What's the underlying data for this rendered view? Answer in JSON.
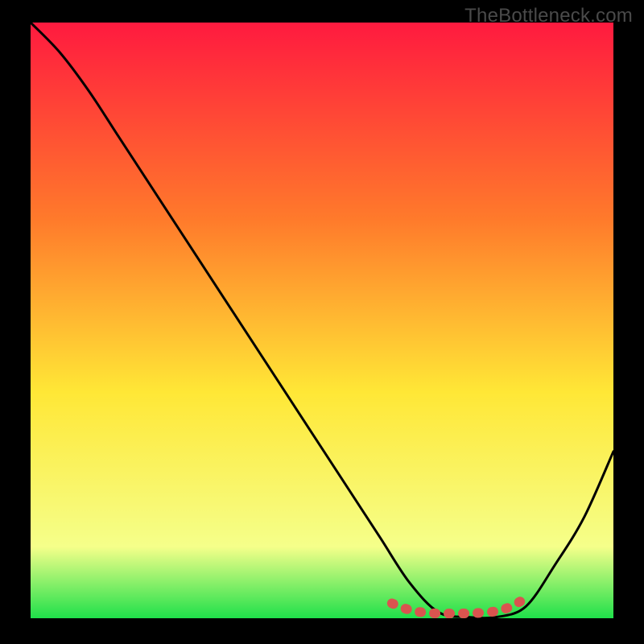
{
  "watermark": "TheBottleneck.com",
  "chart_data": {
    "type": "line",
    "title": "",
    "xlabel": "",
    "ylabel": "",
    "xlim": [
      0,
      100
    ],
    "ylim": [
      0,
      100
    ],
    "grid": false,
    "x": [
      0,
      5,
      10,
      15,
      20,
      25,
      30,
      35,
      40,
      45,
      50,
      55,
      60,
      65,
      70,
      75,
      80,
      85,
      90,
      95,
      100
    ],
    "series": [
      {
        "name": "bottleneck-curve",
        "color": "#000000",
        "values": [
          100,
          95,
          88.5,
          81,
          73.5,
          66,
          58.5,
          51,
          43.5,
          36,
          28.5,
          21,
          13.5,
          6,
          1,
          0.2,
          0.2,
          2,
          9,
          17,
          28
        ]
      }
    ],
    "highlight": {
      "name": "optimal-range",
      "color": "#d9544f",
      "x": [
        62,
        65,
        68,
        71,
        74,
        77,
        80,
        82,
        84
      ],
      "values": [
        2.5,
        1.4,
        0.9,
        0.8,
        0.8,
        0.9,
        1.2,
        1.8,
        2.8
      ]
    },
    "background_gradient": {
      "top": "#ff1a3f",
      "mid1": "#ff7a2b",
      "mid2": "#ffe736",
      "low": "#f5ff8a",
      "bottom": "#1fe04a"
    }
  }
}
